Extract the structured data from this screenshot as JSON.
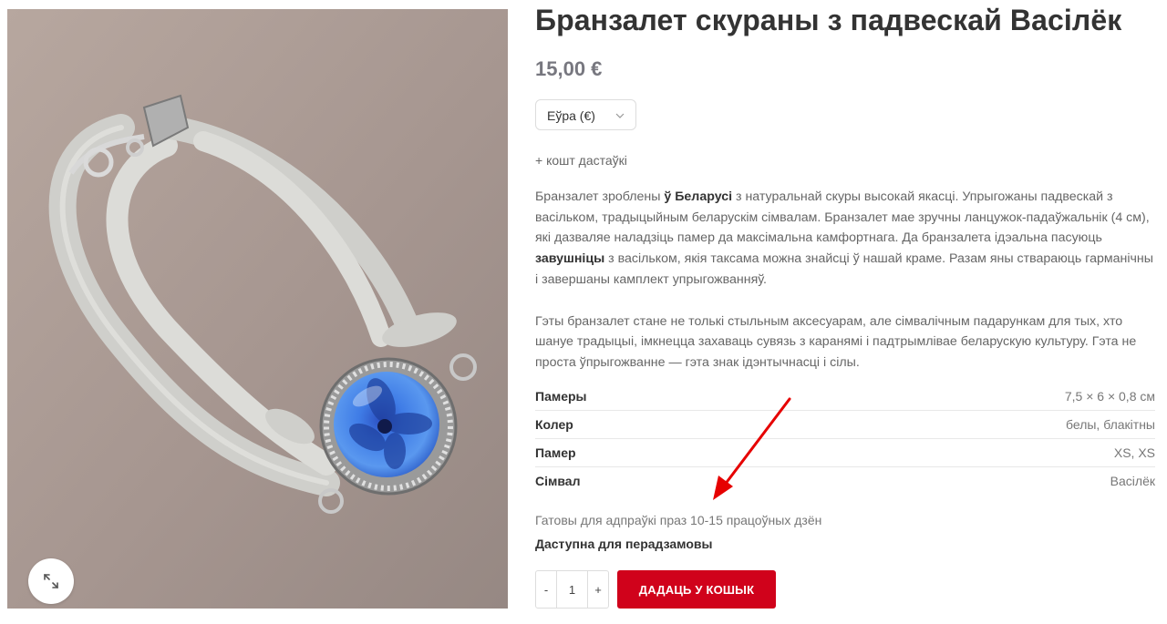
{
  "product": {
    "title": "Бранзалет скураны з падвескай Васілёк",
    "price": "15,00 €",
    "image_alt": "Бранзалет скураны з падвескай Васілёк"
  },
  "currency_select": {
    "selected": "Еўра (€)",
    "icon": "chevron-down-icon"
  },
  "shipping_note": "+ кошт дастаўкі",
  "description": {
    "p1": {
      "t1": "Бранзалет зроблены ",
      "b1": "ў Беларусі",
      "t2": " з натуральнай скуры высокай якасці. Упрыгожаны падвескай з васільком, традыцыйным беларускім сімвалам. Бранзалет мае зручны ланцужок-падаўжальнік (4 см), які дазваляе наладзіць памер да максімальна камфортнага. Да бранзалета ідэальна пасуюць ",
      "b2": "завушніцы",
      "t3": " з васільком, якія таксама можна знайсці ў нашай краме. Разам яны ствараюць гарманічны і завершаны камплект упрыгожванняў."
    },
    "p2": "Гэты бранзалет стане не толькі стыльным аксесуарам, але сімвалічным падарункам для тых, хто шануе традыцыі, імкнецца захаваць сувязь з каранямі і падтрымлівае беларускую культуру. Гэта не проста ўпрыгожванне — гэта знак ідэнтычнасці і сілы."
  },
  "attributes": [
    {
      "label": "Памеры",
      "value": "7,5 × 6 × 0,8 см"
    },
    {
      "label": "Колер",
      "value": "белы, блакітны"
    },
    {
      "label": "Памер",
      "value": "XS, XS"
    },
    {
      "label": "Сімвал",
      "value": "Васілёк"
    }
  ],
  "ready_note": "Гатовы для адпраўкі праз 10-15 працоўных дзён",
  "availability": "Даступна для перадзамовы",
  "quantity": {
    "minus": "-",
    "value": "1",
    "plus": "+"
  },
  "add_to_cart": "ДАДАЦЬ У КОШЫК",
  "colors": {
    "accent": "#d0021b",
    "annotation_arrow": "#e60000",
    "price": "#77777f"
  },
  "icons": {
    "zoom": "expand-icon"
  }
}
